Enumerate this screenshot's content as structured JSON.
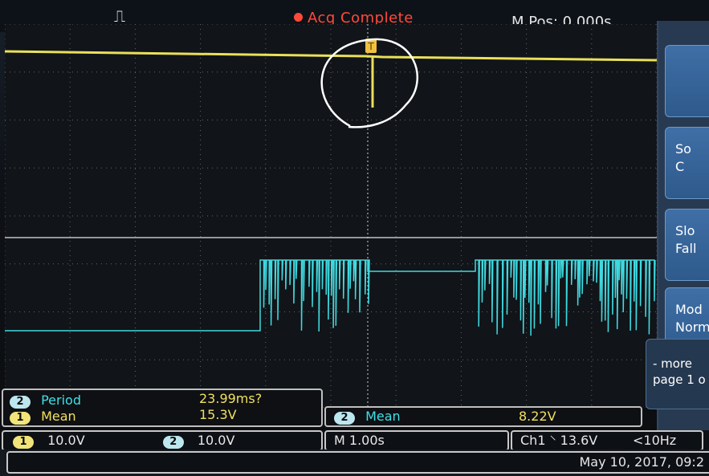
{
  "top_bar": {
    "trigger_icon": "pulse-trigger-icon",
    "acquisition_status": "Acq Complete",
    "horizontal_position": "M Pos: 0.000s"
  },
  "side_menu": {
    "softkeys": [
      {
        "id": "type",
        "label": ""
      },
      {
        "id": "source",
        "label": "So",
        "sub": "C"
      },
      {
        "id": "slope",
        "label": "Slo",
        "sub": "Fall"
      },
      {
        "id": "mode",
        "label": "Mod",
        "sub": "Norm"
      }
    ],
    "more": {
      "line1": "- more",
      "line2": "page 1 o"
    }
  },
  "measurements_left": [
    {
      "channel": "2",
      "name": "Period",
      "value": "23.99ms?",
      "color": "cyan"
    },
    {
      "channel": "1",
      "name": "Mean",
      "value": "15.3V",
      "color": "yellow"
    }
  ],
  "measurements_right": [
    {
      "channel": "2",
      "name": "Mean",
      "value": "8.22V",
      "color": "cyan"
    }
  ],
  "status_bar": {
    "ch1": {
      "channel": "1",
      "scale": "10.0V"
    },
    "ch2": {
      "channel": "2",
      "scale": "10.0V"
    },
    "timebase": "M 1.00s",
    "trigger": "Ch1 ⸌ 13.6V",
    "trigger_freq": "<10Hz"
  },
  "date_time": "May 10, 2017, 09:2",
  "colors": {
    "ch1": "#f0e060",
    "ch2": "#3fe0e6",
    "acq": "#ff4a3a",
    "softkey": "#2e5a8c"
  }
}
